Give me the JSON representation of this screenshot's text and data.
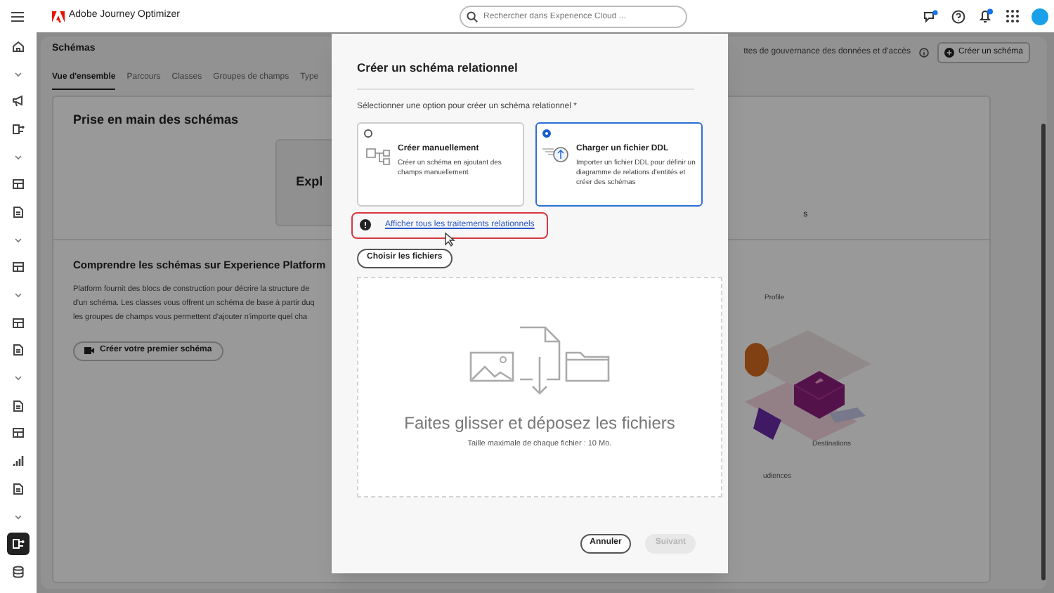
{
  "app": {
    "name": "Adobe Journey Optimizer"
  },
  "search": {
    "placeholder": "Rechercher dans Experience Cloud ..."
  },
  "rail": [
    {
      "kind": "home",
      "selected": false
    },
    {
      "kind": "collapse",
      "selected": false
    },
    {
      "kind": "megaphone",
      "selected": false
    },
    {
      "kind": "branch",
      "selected": false
    },
    {
      "kind": "collapse",
      "selected": false
    },
    {
      "kind": "grid",
      "selected": false
    },
    {
      "kind": "document",
      "selected": false
    },
    {
      "kind": "collapse",
      "selected": false
    },
    {
      "kind": "grid",
      "selected": false
    },
    {
      "kind": "collapse",
      "selected": false
    },
    {
      "kind": "grid",
      "selected": false
    },
    {
      "kind": "document",
      "selected": false
    },
    {
      "kind": "collapse",
      "selected": false
    },
    {
      "kind": "document",
      "selected": false
    },
    {
      "kind": "grid",
      "selected": false
    },
    {
      "kind": "bars",
      "selected": false
    },
    {
      "kind": "document",
      "selected": false
    },
    {
      "kind": "collapse",
      "selected": false
    },
    {
      "kind": "branch",
      "selected": true
    },
    {
      "kind": "database",
      "selected": false
    }
  ],
  "page": {
    "title": "Schémas",
    "tabs": [
      {
        "label": "Vue d'ensemble",
        "selected": true
      },
      {
        "label": "Parcours",
        "selected": false
      },
      {
        "label": "Classes",
        "selected": false
      },
      {
        "label": "Groupes de champs",
        "selected": false
      },
      {
        "label": "Type",
        "selected": false
      }
    ],
    "header_text": "ttes de gouvernance des données et d'accès",
    "create_button": "Créer un schéma"
  },
  "getting_started": {
    "title": "Prise en main des schémas",
    "card_text": "Expl",
    "fragment": "s"
  },
  "understand": {
    "title": "Comprendre les schémas sur Experience Platform",
    "paragraph": [
      "Platform fournit des blocs de construction pour décrire la structure de",
      "d'un schéma. Les classes vous offrent un schéma de base à partir duq",
      "les groupes de champs vous permettent d'ajouter n'importe quel cha"
    ],
    "button": "Créer votre premier schéma"
  },
  "illustration": {
    "labels": [
      "Profile",
      "Destinations",
      "udiences"
    ]
  },
  "dialog": {
    "title": "Créer un schéma relationnel",
    "prompt": "Sélectionner une option pour créer un schéma relationnel *",
    "options": [
      {
        "title": "Créer manuellement",
        "description": "Créer un schéma en ajoutant des champs manuellement",
        "selected": false
      },
      {
        "title": "Charger un fichier DDL",
        "description": "Importer un fichier DDL pour définir un diagramme de relations d'entités et créer des schémas",
        "selected": true
      }
    ],
    "link": "Afficher tous les traitements relationnels",
    "choose_button": "Choisir les fichiers",
    "dropzone": {
      "title": "Faites glisser et déposez les fichiers",
      "hint": "Taille maximale de chaque fichier : 10 Mo."
    },
    "buttons": [
      {
        "label": "Annuler",
        "disabled": false
      },
      {
        "label": "Suivant",
        "disabled": true
      }
    ]
  }
}
